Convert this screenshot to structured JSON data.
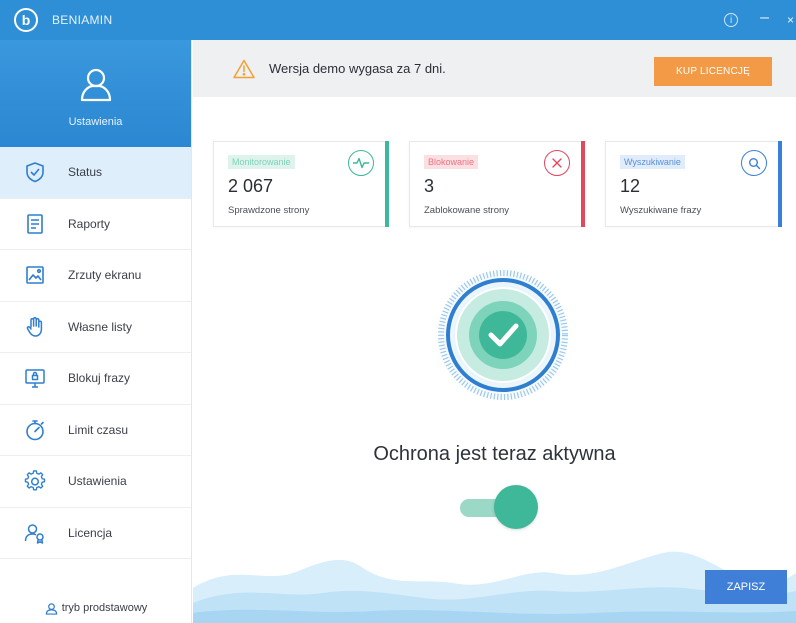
{
  "app": {
    "logo_letter": "b",
    "title": "BENIAMIN",
    "info_symbol": "i",
    "minimize_symbol": "–",
    "close_symbol": "×"
  },
  "sidebar": {
    "header_label": "Ustawienia",
    "header_icon": "user-outline-icon",
    "items": [
      {
        "label": "Status",
        "icon": "shield-check-icon",
        "active": true
      },
      {
        "label": "Raporty",
        "icon": "document-icon",
        "active": false
      },
      {
        "label": "Zrzuty ekranu",
        "icon": "image-icon",
        "active": false
      },
      {
        "label": "Własne listy",
        "icon": "hand-icon",
        "active": false
      },
      {
        "label": "Blokuj frazy",
        "icon": "monitor-lock-icon",
        "active": false
      },
      {
        "label": "Limit czasu",
        "icon": "stopwatch-icon",
        "active": false
      },
      {
        "label": "Ustawienia",
        "icon": "gear-icon",
        "active": false
      },
      {
        "label": "Licencja",
        "icon": "license-user-icon",
        "active": false
      }
    ],
    "footer_label": "tryb prodstawowy"
  },
  "banner": {
    "text": "Wersja demo wygasa za 7 dni.",
    "buy_label": "KUP LICENCJĘ"
  },
  "cards": [
    {
      "tag": "Monitorowanie",
      "value": "2 067",
      "sub": "Sprawdzone strony",
      "icon": "pulse-icon",
      "color": "#3cb89a",
      "tag_bg": "#ddf3ec"
    },
    {
      "tag": "Blokowanie",
      "value": "3",
      "sub": "Zablokowane strony",
      "icon": "x-circle-icon",
      "color": "#e0485b",
      "tag_bg": "#fbe0e3"
    },
    {
      "tag": "Wyszukiwanie",
      "value": "12",
      "sub": "Wyszukiwane frazy",
      "icon": "search-icon",
      "color": "#3a7fd6",
      "tag_bg": "#e1ecfa"
    }
  ],
  "protection": {
    "status_text": "Ochrona jest teraz aktywna",
    "enabled": true
  },
  "actions": {
    "save_label": "ZAPISZ"
  },
  "colors": {
    "primary": "#2f8fd6",
    "accent_orange": "#f29a45",
    "green": "#3fb89a",
    "save_blue": "#3f7fd8"
  }
}
